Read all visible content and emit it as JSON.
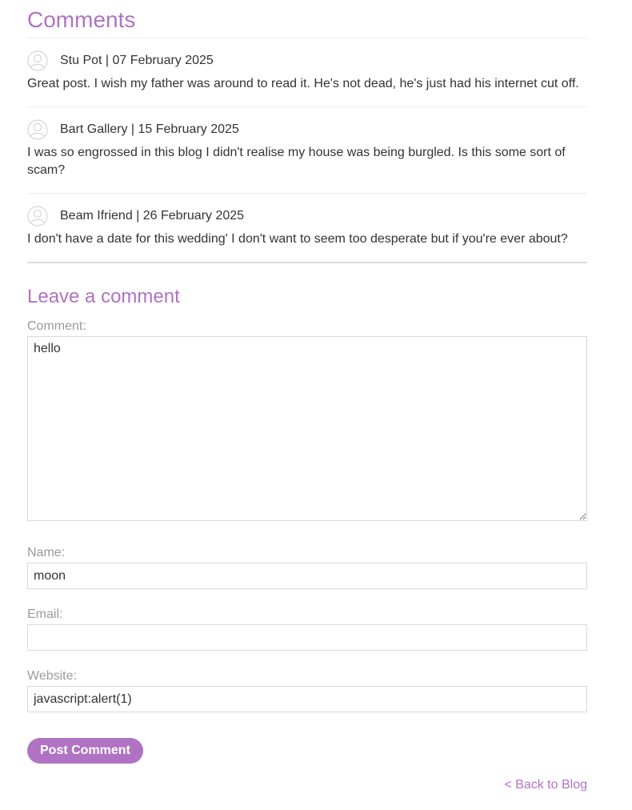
{
  "comments_section": {
    "title": "Comments",
    "comments": [
      {
        "meta": "Stu Pot | 07 February 2025",
        "body": "Great post. I wish my father was around to read it. He's not dead, he's just had his internet cut off."
      },
      {
        "meta": "Bart Gallery | 15 February 2025",
        "body": "I was so engrossed in this blog I didn't realise my house was being burgled. Is this some sort of scam?"
      },
      {
        "meta": "Beam Ifriend | 26 February 2025",
        "body": "I don't have a date for this wedding' I don't want to seem too desperate but if you're ever about?"
      }
    ]
  },
  "form": {
    "title": "Leave a comment",
    "comment_label": "Comment:",
    "comment_value": "hello",
    "name_label": "Name:",
    "name_value": "moon",
    "email_label": "Email:",
    "email_value": "",
    "website_label": "Website:",
    "website_value": "javascript:alert(1)",
    "submit_label": "Post Comment"
  },
  "footer": {
    "back_link": "< Back to Blog"
  },
  "colors": {
    "accent": "#b073c4",
    "text": "#333333",
    "label": "#999999",
    "border": "#d9d9d9"
  }
}
